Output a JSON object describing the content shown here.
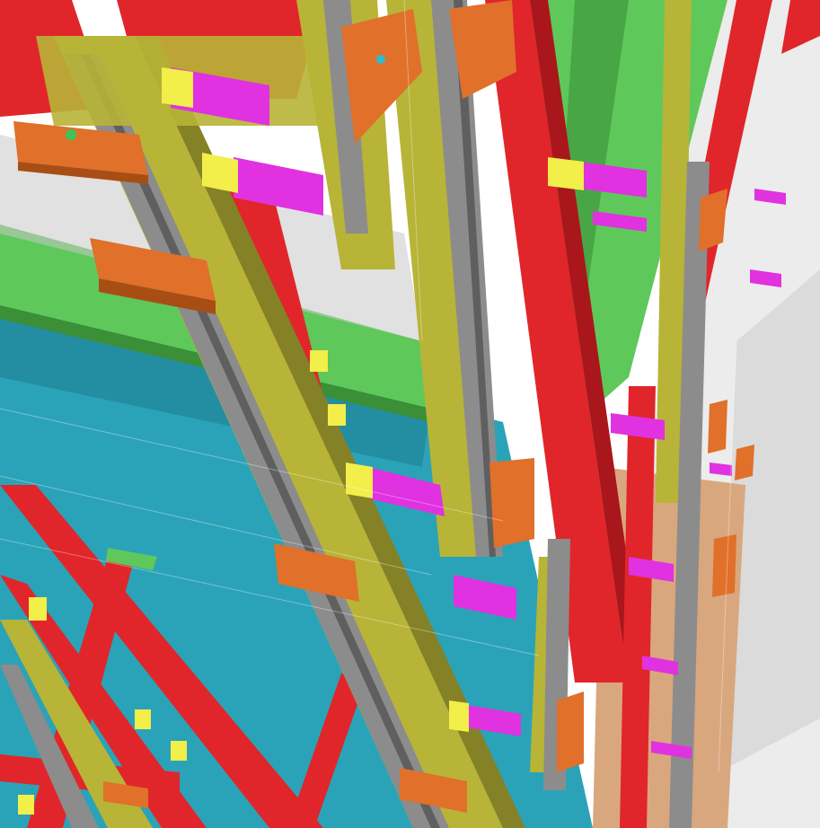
{
  "scene": {
    "kind": "3d-model-viewport",
    "background": "#ffffff",
    "colors": {
      "steel_red": "#e0262a",
      "steel_red_dark": "#a9161b",
      "slab_green": "#5fc85a",
      "slab_green_dark": "#3b8f36",
      "panel_cyan": "#2aa3b8",
      "panel_cyan_dark": "#1d7d8f",
      "mullion_olive": "#b8b437",
      "mullion_olive_dark": "#858126",
      "profile_gray": "#8c8c8c",
      "profile_gray_dark": "#5f5f5f",
      "bracket_orange": "#e0702a",
      "bracket_orange_dark": "#a84e15",
      "anchor_magenta": "#e032e0",
      "anchor_yellow": "#f2ee4a",
      "wood_tan": "#d9a77e",
      "glass_ghost": "#c8c8c8"
    }
  }
}
